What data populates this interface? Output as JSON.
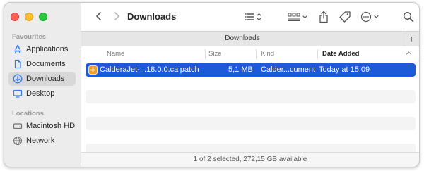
{
  "sidebar": {
    "favourites_label": "Favourites",
    "favourites": [
      {
        "label": "Applications",
        "icon": "applications-icon"
      },
      {
        "label": "Documents",
        "icon": "document-icon"
      },
      {
        "label": "Downloads",
        "icon": "downloads-icon",
        "active": true
      },
      {
        "label": "Desktop",
        "icon": "desktop-icon"
      }
    ],
    "locations_label": "Locations",
    "locations": [
      {
        "label": "Macintosh HD",
        "icon": "hard-drive-icon"
      },
      {
        "label": "Network",
        "icon": "network-icon"
      }
    ]
  },
  "toolbar": {
    "title": "Downloads",
    "icons": [
      "back-icon",
      "forward-icon",
      "list-view-icon",
      "group-icon",
      "share-icon",
      "tag-icon",
      "more-icon",
      "search-icon"
    ]
  },
  "tabbar": {
    "label": "Downloads",
    "add": "+"
  },
  "columns": {
    "name": "Name",
    "size": "Size",
    "kind": "Kind",
    "date_added": "Date Added",
    "sort_indicator": "^"
  },
  "files": [
    {
      "name": "CalderaJet-...18.0.0.calpatch",
      "size": "5,1 MB",
      "kind": "Calder...cument",
      "date_added": "Today at 15:09",
      "selected": true
    }
  ],
  "status": {
    "text": "1 of 2 selected, 272,15 GB available"
  },
  "colors": {
    "selection": "#1d5ad8",
    "sidebar_bg": "#ececec",
    "active_sidebar": "#d8d8d8",
    "icon_blue": "#2f7bf5",
    "file_icon_orange": "#f39c2a"
  }
}
